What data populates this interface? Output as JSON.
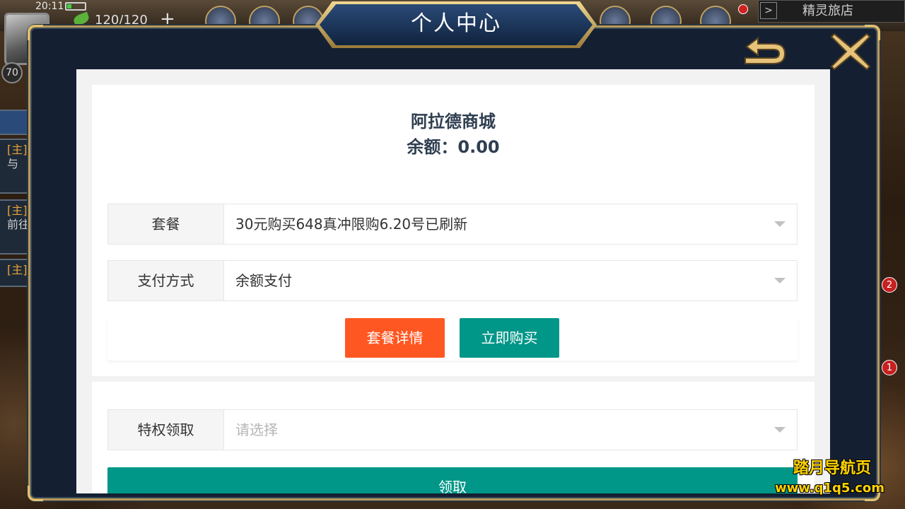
{
  "status_bar": {
    "time": "20:11"
  },
  "hud": {
    "energy": "120/120",
    "plus": "+",
    "level": "70",
    "inn_button": "精灵旅店",
    "inn_arrow": ">",
    "left_tabs": [
      {
        "tag": "[主]",
        "sub": "与"
      },
      {
        "tag": "[主]",
        "sub": "前往"
      },
      {
        "tag": "[主]",
        "sub": ""
      }
    ],
    "badges": [
      "2",
      "1"
    ]
  },
  "modal": {
    "title": "个人中心",
    "back_icon": "back-arrow-icon",
    "close_icon": "close-x-icon"
  },
  "shop": {
    "name": "阿拉德商城",
    "balance_label": "余额：",
    "balance_value": "0.00",
    "package": {
      "label": "套餐",
      "value": "30元购买648真冲限购6.20号已刷新"
    },
    "payment": {
      "label": "支付方式",
      "value": "余额支付"
    },
    "buttons": {
      "detail": "套餐详情",
      "buy": "立即购买"
    },
    "privilege": {
      "label": "特权领取",
      "placeholder": "请选择"
    },
    "claim": "领取"
  },
  "watermark": {
    "line1": "踏月导航页",
    "line2": "www.q1q5.com"
  },
  "colors": {
    "orange": "#ff5722",
    "teal": "#009688",
    "frame_gold": "#b89a5a",
    "modal_bg": "#142032"
  }
}
